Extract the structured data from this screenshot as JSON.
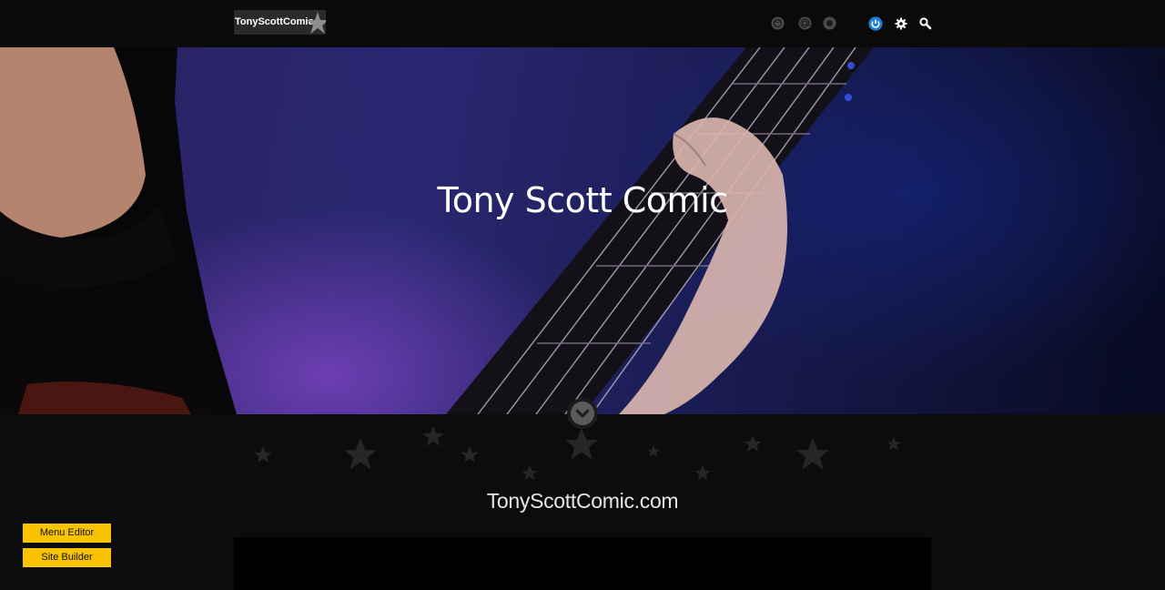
{
  "header": {
    "logo_text": "TonyScottComic",
    "social_icons": [
      "dribbble-icon",
      "at-sign-icon",
      "circle-icon"
    ],
    "tools": [
      "power-icon",
      "gear-icon",
      "search-icon"
    ],
    "accent_color": "#1e7fd6"
  },
  "hero": {
    "title": "Tony Scott Comic"
  },
  "main": {
    "domain_title": "TonyScottComic.com"
  },
  "admin": {
    "menu_editor_label": "Menu Editor",
    "site_builder_label": "Site Builder",
    "button_color": "#f9c300"
  }
}
